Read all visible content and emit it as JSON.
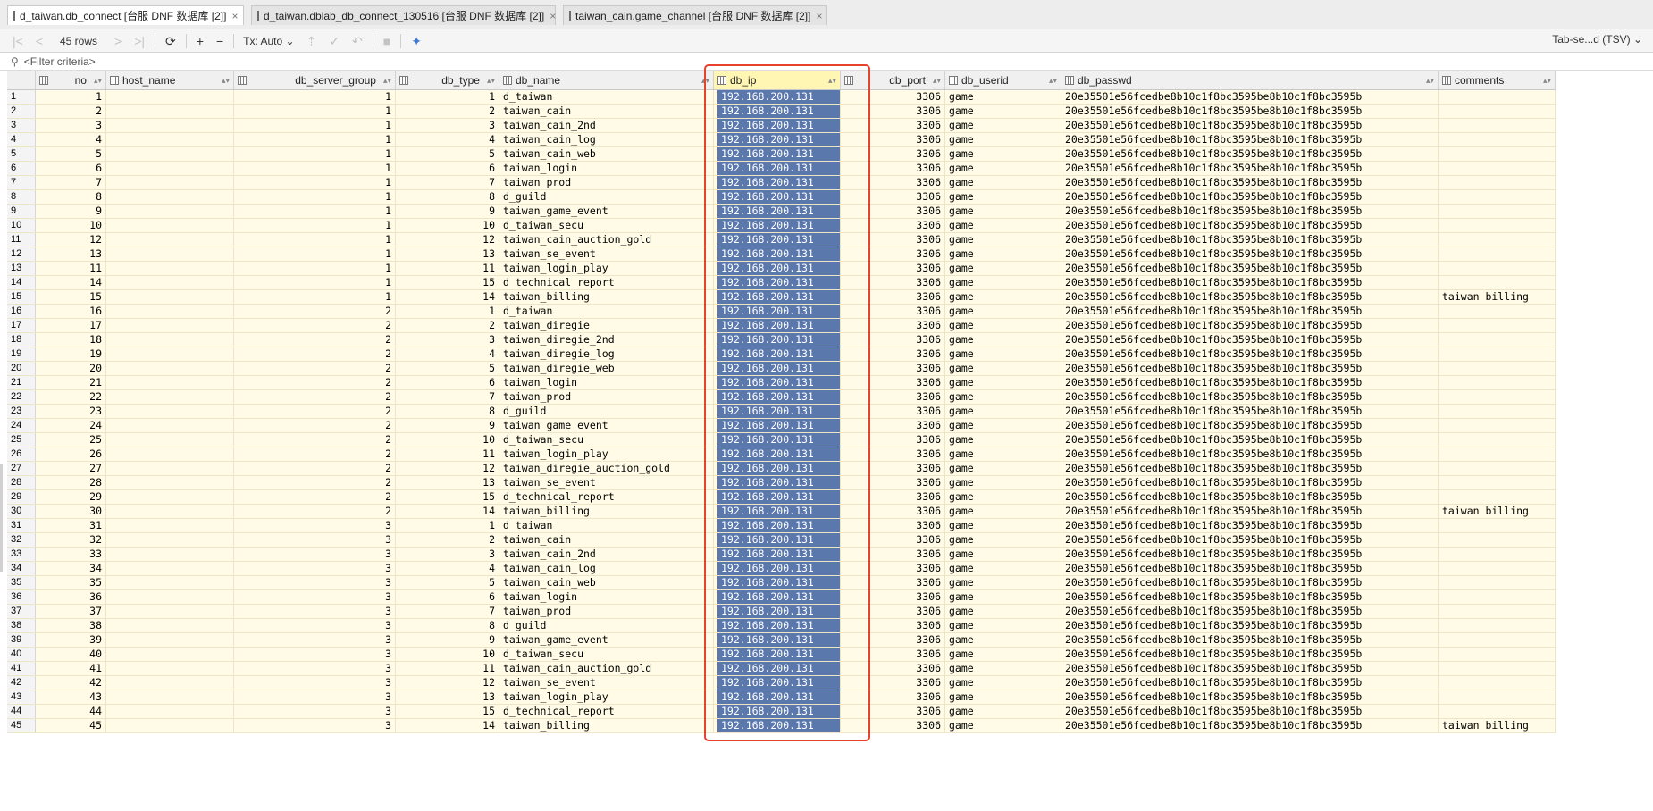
{
  "tabs": [
    {
      "label": "d_taiwan.db_connect [台服 DNF 数据库 [2]]",
      "active": true
    },
    {
      "label": "d_taiwan.dblab_db_connect_130516 [台服 DNF 数据库 [2]]",
      "active": false
    },
    {
      "label": "taiwan_cain.game_channel [台服 DNF 数据库 [2]]",
      "active": false
    }
  ],
  "toolbar": {
    "rows_label": "45 rows",
    "tx_label": "Tx: Auto",
    "format_label": "Tab-se...d (TSV)"
  },
  "filter": {
    "placeholder": "<Filter criteria>"
  },
  "columns": [
    "no",
    "host_name",
    "db_server_group",
    "db_type",
    "db_name",
    "db_ip",
    "db_port",
    "db_userid",
    "db_passwd",
    "comments"
  ],
  "rows": [
    {
      "rn": "1",
      "no": "1",
      "host": "",
      "group": "1",
      "type": "1",
      "name": "d_taiwan",
      "ip": "192.168.200.131",
      "port": "3306",
      "user": "game",
      "passwd": "20e35501e56fcedbe8b10c1f8bc3595be8b10c1f8bc3595b",
      "comments": ""
    },
    {
      "rn": "2",
      "no": "2",
      "host": "",
      "group": "1",
      "type": "2",
      "name": "taiwan_cain",
      "ip": "192.168.200.131",
      "port": "3306",
      "user": "game",
      "passwd": "20e35501e56fcedbe8b10c1f8bc3595be8b10c1f8bc3595b",
      "comments": ""
    },
    {
      "rn": "3",
      "no": "3",
      "host": "",
      "group": "1",
      "type": "3",
      "name": "taiwan_cain_2nd",
      "ip": "192.168.200.131",
      "port": "3306",
      "user": "game",
      "passwd": "20e35501e56fcedbe8b10c1f8bc3595be8b10c1f8bc3595b",
      "comments": ""
    },
    {
      "rn": "4",
      "no": "4",
      "host": "",
      "group": "1",
      "type": "4",
      "name": "taiwan_cain_log",
      "ip": "192.168.200.131",
      "port": "3306",
      "user": "game",
      "passwd": "20e35501e56fcedbe8b10c1f8bc3595be8b10c1f8bc3595b",
      "comments": ""
    },
    {
      "rn": "5",
      "no": "5",
      "host": "",
      "group": "1",
      "type": "5",
      "name": "taiwan_cain_web",
      "ip": "192.168.200.131",
      "port": "3306",
      "user": "game",
      "passwd": "20e35501e56fcedbe8b10c1f8bc3595be8b10c1f8bc3595b",
      "comments": ""
    },
    {
      "rn": "6",
      "no": "6",
      "host": "",
      "group": "1",
      "type": "6",
      "name": "taiwan_login",
      "ip": "192.168.200.131",
      "port": "3306",
      "user": "game",
      "passwd": "20e35501e56fcedbe8b10c1f8bc3595be8b10c1f8bc3595b",
      "comments": ""
    },
    {
      "rn": "7",
      "no": "7",
      "host": "",
      "group": "1",
      "type": "7",
      "name": "taiwan_prod",
      "ip": "192.168.200.131",
      "port": "3306",
      "user": "game",
      "passwd": "20e35501e56fcedbe8b10c1f8bc3595be8b10c1f8bc3595b",
      "comments": ""
    },
    {
      "rn": "8",
      "no": "8",
      "host": "",
      "group": "1",
      "type": "8",
      "name": "d_guild",
      "ip": "192.168.200.131",
      "port": "3306",
      "user": "game",
      "passwd": "20e35501e56fcedbe8b10c1f8bc3595be8b10c1f8bc3595b",
      "comments": ""
    },
    {
      "rn": "9",
      "no": "9",
      "host": "",
      "group": "1",
      "type": "9",
      "name": "taiwan_game_event",
      "ip": "192.168.200.131",
      "port": "3306",
      "user": "game",
      "passwd": "20e35501e56fcedbe8b10c1f8bc3595be8b10c1f8bc3595b",
      "comments": ""
    },
    {
      "rn": "10",
      "no": "10",
      "host": "",
      "group": "1",
      "type": "10",
      "name": "d_taiwan_secu",
      "ip": "192.168.200.131",
      "port": "3306",
      "user": "game",
      "passwd": "20e35501e56fcedbe8b10c1f8bc3595be8b10c1f8bc3595b",
      "comments": ""
    },
    {
      "rn": "11",
      "no": "12",
      "host": "",
      "group": "1",
      "type": "12",
      "name": "taiwan_cain_auction_gold",
      "ip": "192.168.200.131",
      "port": "3306",
      "user": "game",
      "passwd": "20e35501e56fcedbe8b10c1f8bc3595be8b10c1f8bc3595b",
      "comments": ""
    },
    {
      "rn": "12",
      "no": "13",
      "host": "",
      "group": "1",
      "type": "13",
      "name": "taiwan_se_event",
      "ip": "192.168.200.131",
      "port": "3306",
      "user": "game",
      "passwd": "20e35501e56fcedbe8b10c1f8bc3595be8b10c1f8bc3595b",
      "comments": ""
    },
    {
      "rn": "13",
      "no": "11",
      "host": "",
      "group": "1",
      "type": "11",
      "name": "taiwan_login_play",
      "ip": "192.168.200.131",
      "port": "3306",
      "user": "game",
      "passwd": "20e35501e56fcedbe8b10c1f8bc3595be8b10c1f8bc3595b",
      "comments": ""
    },
    {
      "rn": "14",
      "no": "14",
      "host": "",
      "group": "1",
      "type": "15",
      "name": "d_technical_report",
      "ip": "192.168.200.131",
      "port": "3306",
      "user": "game",
      "passwd": "20e35501e56fcedbe8b10c1f8bc3595be8b10c1f8bc3595b",
      "comments": ""
    },
    {
      "rn": "15",
      "no": "15",
      "host": "",
      "group": "1",
      "type": "14",
      "name": "taiwan_billing",
      "ip": "192.168.200.131",
      "port": "3306",
      "user": "game",
      "passwd": "20e35501e56fcedbe8b10c1f8bc3595be8b10c1f8bc3595b",
      "comments": "taiwan billing"
    },
    {
      "rn": "16",
      "no": "16",
      "host": "",
      "group": "2",
      "type": "1",
      "name": "d_taiwan",
      "ip": "192.168.200.131",
      "port": "3306",
      "user": "game",
      "passwd": "20e35501e56fcedbe8b10c1f8bc3595be8b10c1f8bc3595b",
      "comments": ""
    },
    {
      "rn": "17",
      "no": "17",
      "host": "",
      "group": "2",
      "type": "2",
      "name": "taiwan_diregie",
      "ip": "192.168.200.131",
      "port": "3306",
      "user": "game",
      "passwd": "20e35501e56fcedbe8b10c1f8bc3595be8b10c1f8bc3595b",
      "comments": ""
    },
    {
      "rn": "18",
      "no": "18",
      "host": "",
      "group": "2",
      "type": "3",
      "name": "taiwan_diregie_2nd",
      "ip": "192.168.200.131",
      "port": "3306",
      "user": "game",
      "passwd": "20e35501e56fcedbe8b10c1f8bc3595be8b10c1f8bc3595b",
      "comments": ""
    },
    {
      "rn": "19",
      "no": "19",
      "host": "",
      "group": "2",
      "type": "4",
      "name": "taiwan_diregie_log",
      "ip": "192.168.200.131",
      "port": "3306",
      "user": "game",
      "passwd": "20e35501e56fcedbe8b10c1f8bc3595be8b10c1f8bc3595b",
      "comments": ""
    },
    {
      "rn": "20",
      "no": "20",
      "host": "",
      "group": "2",
      "type": "5",
      "name": "taiwan_diregie_web",
      "ip": "192.168.200.131",
      "port": "3306",
      "user": "game",
      "passwd": "20e35501e56fcedbe8b10c1f8bc3595be8b10c1f8bc3595b",
      "comments": ""
    },
    {
      "rn": "21",
      "no": "21",
      "host": "",
      "group": "2",
      "type": "6",
      "name": "taiwan_login",
      "ip": "192.168.200.131",
      "port": "3306",
      "user": "game",
      "passwd": "20e35501e56fcedbe8b10c1f8bc3595be8b10c1f8bc3595b",
      "comments": ""
    },
    {
      "rn": "22",
      "no": "22",
      "host": "",
      "group": "2",
      "type": "7",
      "name": "taiwan_prod",
      "ip": "192.168.200.131",
      "port": "3306",
      "user": "game",
      "passwd": "20e35501e56fcedbe8b10c1f8bc3595be8b10c1f8bc3595b",
      "comments": ""
    },
    {
      "rn": "23",
      "no": "23",
      "host": "",
      "group": "2",
      "type": "8",
      "name": "d_guild",
      "ip": "192.168.200.131",
      "port": "3306",
      "user": "game",
      "passwd": "20e35501e56fcedbe8b10c1f8bc3595be8b10c1f8bc3595b",
      "comments": ""
    },
    {
      "rn": "24",
      "no": "24",
      "host": "",
      "group": "2",
      "type": "9",
      "name": "taiwan_game_event",
      "ip": "192.168.200.131",
      "port": "3306",
      "user": "game",
      "passwd": "20e35501e56fcedbe8b10c1f8bc3595be8b10c1f8bc3595b",
      "comments": ""
    },
    {
      "rn": "25",
      "no": "25",
      "host": "",
      "group": "2",
      "type": "10",
      "name": "d_taiwan_secu",
      "ip": "192.168.200.131",
      "port": "3306",
      "user": "game",
      "passwd": "20e35501e56fcedbe8b10c1f8bc3595be8b10c1f8bc3595b",
      "comments": ""
    },
    {
      "rn": "26",
      "no": "26",
      "host": "",
      "group": "2",
      "type": "11",
      "name": "taiwan_login_play",
      "ip": "192.168.200.131",
      "port": "3306",
      "user": "game",
      "passwd": "20e35501e56fcedbe8b10c1f8bc3595be8b10c1f8bc3595b",
      "comments": ""
    },
    {
      "rn": "27",
      "no": "27",
      "host": "",
      "group": "2",
      "type": "12",
      "name": "taiwan_diregie_auction_gold",
      "ip": "192.168.200.131",
      "port": "3306",
      "user": "game",
      "passwd": "20e35501e56fcedbe8b10c1f8bc3595be8b10c1f8bc3595b",
      "comments": ""
    },
    {
      "rn": "28",
      "no": "28",
      "host": "",
      "group": "2",
      "type": "13",
      "name": "taiwan_se_event",
      "ip": "192.168.200.131",
      "port": "3306",
      "user": "game",
      "passwd": "20e35501e56fcedbe8b10c1f8bc3595be8b10c1f8bc3595b",
      "comments": ""
    },
    {
      "rn": "29",
      "no": "29",
      "host": "",
      "group": "2",
      "type": "15",
      "name": "d_technical_report",
      "ip": "192.168.200.131",
      "port": "3306",
      "user": "game",
      "passwd": "20e35501e56fcedbe8b10c1f8bc3595be8b10c1f8bc3595b",
      "comments": ""
    },
    {
      "rn": "30",
      "no": "30",
      "host": "",
      "group": "2",
      "type": "14",
      "name": "taiwan_billing",
      "ip": "192.168.200.131",
      "port": "3306",
      "user": "game",
      "passwd": "20e35501e56fcedbe8b10c1f8bc3595be8b10c1f8bc3595b",
      "comments": "taiwan billing"
    },
    {
      "rn": "31",
      "no": "31",
      "host": "",
      "group": "3",
      "type": "1",
      "name": "d_taiwan",
      "ip": "192.168.200.131",
      "port": "3306",
      "user": "game",
      "passwd": "20e35501e56fcedbe8b10c1f8bc3595be8b10c1f8bc3595b",
      "comments": ""
    },
    {
      "rn": "32",
      "no": "32",
      "host": "",
      "group": "3",
      "type": "2",
      "name": "taiwan_cain",
      "ip": "192.168.200.131",
      "port": "3306",
      "user": "game",
      "passwd": "20e35501e56fcedbe8b10c1f8bc3595be8b10c1f8bc3595b",
      "comments": ""
    },
    {
      "rn": "33",
      "no": "33",
      "host": "",
      "group": "3",
      "type": "3",
      "name": "taiwan_cain_2nd",
      "ip": "192.168.200.131",
      "port": "3306",
      "user": "game",
      "passwd": "20e35501e56fcedbe8b10c1f8bc3595be8b10c1f8bc3595b",
      "comments": ""
    },
    {
      "rn": "34",
      "no": "34",
      "host": "",
      "group": "3",
      "type": "4",
      "name": "taiwan_cain_log",
      "ip": "192.168.200.131",
      "port": "3306",
      "user": "game",
      "passwd": "20e35501e56fcedbe8b10c1f8bc3595be8b10c1f8bc3595b",
      "comments": ""
    },
    {
      "rn": "35",
      "no": "35",
      "host": "",
      "group": "3",
      "type": "5",
      "name": "taiwan_cain_web",
      "ip": "192.168.200.131",
      "port": "3306",
      "user": "game",
      "passwd": "20e35501e56fcedbe8b10c1f8bc3595be8b10c1f8bc3595b",
      "comments": ""
    },
    {
      "rn": "36",
      "no": "36",
      "host": "",
      "group": "3",
      "type": "6",
      "name": "taiwan_login",
      "ip": "192.168.200.131",
      "port": "3306",
      "user": "game",
      "passwd": "20e35501e56fcedbe8b10c1f8bc3595be8b10c1f8bc3595b",
      "comments": ""
    },
    {
      "rn": "37",
      "no": "37",
      "host": "",
      "group": "3",
      "type": "7",
      "name": "taiwan_prod",
      "ip": "192.168.200.131",
      "port": "3306",
      "user": "game",
      "passwd": "20e35501e56fcedbe8b10c1f8bc3595be8b10c1f8bc3595b",
      "comments": ""
    },
    {
      "rn": "38",
      "no": "38",
      "host": "",
      "group": "3",
      "type": "8",
      "name": "d_guild",
      "ip": "192.168.200.131",
      "port": "3306",
      "user": "game",
      "passwd": "20e35501e56fcedbe8b10c1f8bc3595be8b10c1f8bc3595b",
      "comments": ""
    },
    {
      "rn": "39",
      "no": "39",
      "host": "",
      "group": "3",
      "type": "9",
      "name": "taiwan_game_event",
      "ip": "192.168.200.131",
      "port": "3306",
      "user": "game",
      "passwd": "20e35501e56fcedbe8b10c1f8bc3595be8b10c1f8bc3595b",
      "comments": ""
    },
    {
      "rn": "40",
      "no": "40",
      "host": "",
      "group": "3",
      "type": "10",
      "name": "d_taiwan_secu",
      "ip": "192.168.200.131",
      "port": "3306",
      "user": "game",
      "passwd": "20e35501e56fcedbe8b10c1f8bc3595be8b10c1f8bc3595b",
      "comments": ""
    },
    {
      "rn": "41",
      "no": "41",
      "host": "",
      "group": "3",
      "type": "11",
      "name": "taiwan_cain_auction_gold",
      "ip": "192.168.200.131",
      "port": "3306",
      "user": "game",
      "passwd": "20e35501e56fcedbe8b10c1f8bc3595be8b10c1f8bc3595b",
      "comments": ""
    },
    {
      "rn": "42",
      "no": "42",
      "host": "",
      "group": "3",
      "type": "12",
      "name": "taiwan_se_event",
      "ip": "192.168.200.131",
      "port": "3306",
      "user": "game",
      "passwd": "20e35501e56fcedbe8b10c1f8bc3595be8b10c1f8bc3595b",
      "comments": ""
    },
    {
      "rn": "43",
      "no": "43",
      "host": "",
      "group": "3",
      "type": "13",
      "name": "taiwan_login_play",
      "ip": "192.168.200.131",
      "port": "3306",
      "user": "game",
      "passwd": "20e35501e56fcedbe8b10c1f8bc3595be8b10c1f8bc3595b",
      "comments": ""
    },
    {
      "rn": "44",
      "no": "44",
      "host": "",
      "group": "3",
      "type": "15",
      "name": "d_technical_report",
      "ip": "192.168.200.131",
      "port": "3306",
      "user": "game",
      "passwd": "20e35501e56fcedbe8b10c1f8bc3595be8b10c1f8bc3595b",
      "comments": ""
    },
    {
      "rn": "45",
      "no": "45",
      "host": "",
      "group": "3",
      "type": "14",
      "name": "taiwan_billing",
      "ip": "192.168.200.131",
      "port": "3306",
      "user": "game",
      "passwd": "20e35501e56fcedbe8b10c1f8bc3595be8b10c1f8bc3595b",
      "comments": "taiwan billing"
    }
  ],
  "colors": {
    "selection": "#5b78ad",
    "row_bg": "#fffbe6",
    "highlight_box": "#e8412c"
  }
}
